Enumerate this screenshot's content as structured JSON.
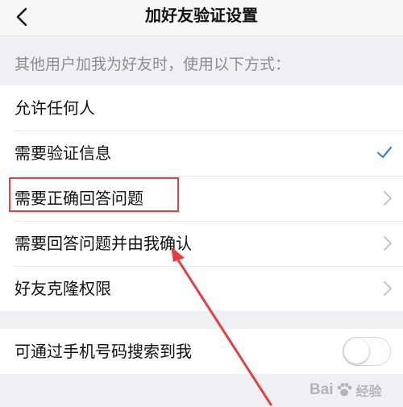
{
  "header": {
    "title": "加好友验证设置",
    "back_icon": "chevron-left-icon"
  },
  "section": {
    "description": "其他用户加我为好友时，使用以下方式："
  },
  "options": [
    {
      "label": "允许任何人",
      "accessory": "none"
    },
    {
      "label": "需要验证信息",
      "accessory": "checkmark",
      "selected": true
    },
    {
      "label": "需要正确回答问题",
      "accessory": "chevron",
      "highlighted": true
    },
    {
      "label": "需要回答问题并由我确认",
      "accessory": "chevron"
    },
    {
      "label": "好友克隆权限",
      "accessory": "chevron"
    }
  ],
  "phone_search": {
    "label": "可通过手机号码搜索到我",
    "enabled": false
  },
  "watermark": {
    "left": "Bai",
    "right": "经验"
  },
  "colors": {
    "accent": "#3b82d6",
    "annotation": "#e04040",
    "secondary_text": "#8c8c92"
  }
}
